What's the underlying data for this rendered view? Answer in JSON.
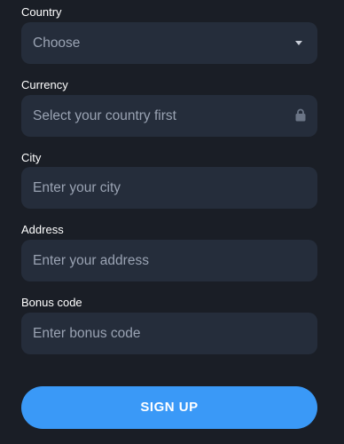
{
  "country": {
    "label": "Country",
    "selected_value": "Choose",
    "icon": "caret-down-icon"
  },
  "currency": {
    "label": "Currency",
    "placeholder": "Select your country first",
    "icon": "lock-icon"
  },
  "city": {
    "label": "City",
    "placeholder": "Enter your city"
  },
  "address": {
    "label": "Address",
    "placeholder": "Enter your address"
  },
  "bonus_code": {
    "label": "Bonus code",
    "placeholder": "Enter bonus code"
  },
  "submit": {
    "label": "SIGN UP"
  },
  "colors": {
    "background": "#1a1e26",
    "field_background": "#252d3b",
    "placeholder_text": "#9aa3b3",
    "accent": "#3a99f7"
  }
}
